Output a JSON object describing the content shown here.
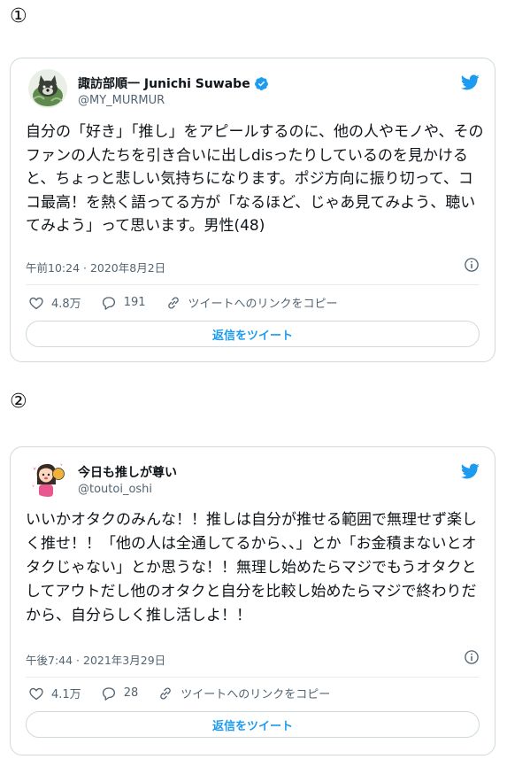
{
  "markers": {
    "first": "①",
    "second": "②"
  },
  "tweets": [
    {
      "display_name": "諏訪部順一 Junichi Suwabe",
      "verified": true,
      "handle": "@MY_MURMUR",
      "text": "自分の「好き」「推し」をアピールするのに、他の人やモノや、そのファンの人たちを引き合いに出しdisったりしているのを見かけると、ちょっと悲しい気持ちになります。ポジ方向に振り切って、ココ最高！を熱く語ってる方が「なるほど、じゃあ見てみよう、聴いてみよう」って思います。男性(48)",
      "timestamp": "午前10:24 · 2020年8月2日",
      "likes": "4.8万",
      "replies": "191",
      "copy_link_label": "ツイートへのリンクをコピー",
      "reply_button_label": "返信をツイート",
      "avatar_icon": "dog-avatar"
    },
    {
      "display_name": "今日も推しが尊い",
      "verified": false,
      "handle": "@toutoi_oshi",
      "text": "いいかオタクのみんな！！推しは自分が推せる範囲で無理せず楽しく推せ！！「他の人は全通してるから、、」とか「お金積まないとオタクじゃない」とか思うな！！無理し始めたらマジでもうオタクとしてアウトだし他のオタクと自分を比較し始めたらマジで終わりだから、自分らしく推し活しよ！！",
      "timestamp": "午後7:44 · 2021年3月29日",
      "likes": "4.1万",
      "replies": "28",
      "copy_link_label": "ツイートへのリンクをコピー",
      "reply_button_label": "返信をツイート",
      "avatar_icon": "fan-girl-avatar"
    }
  ],
  "colors": {
    "accent": "#1d9bf0",
    "text": "#0f1419",
    "secondary": "#536471",
    "border": "#cfd9de"
  }
}
